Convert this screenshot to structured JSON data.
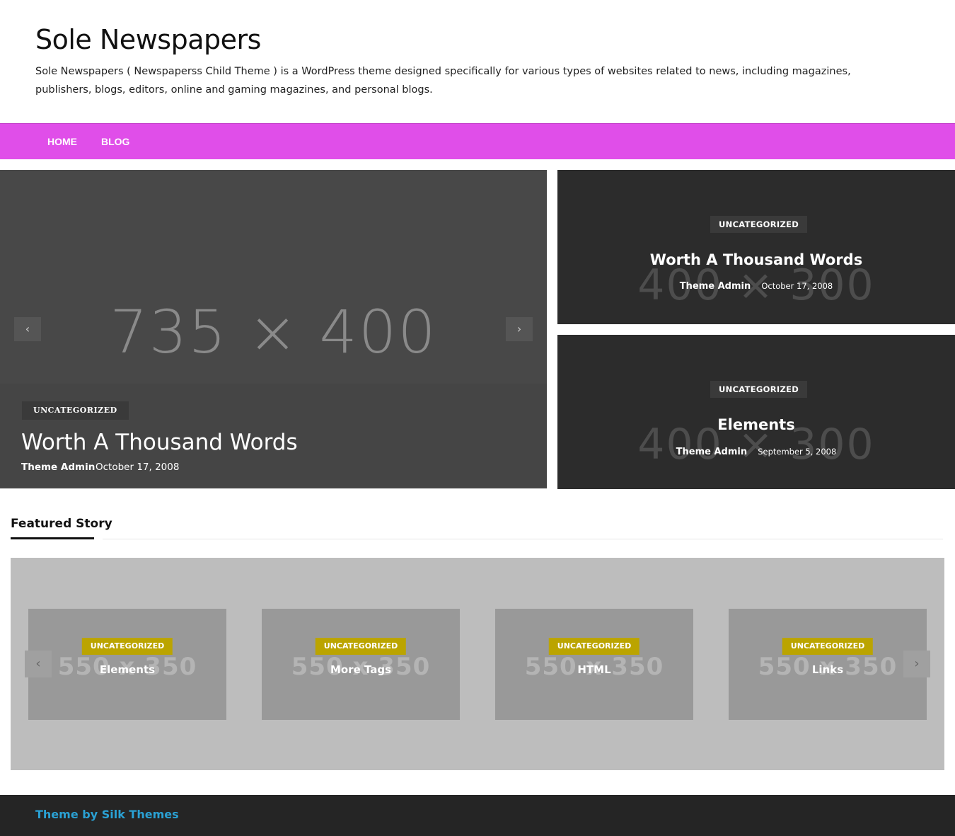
{
  "site": {
    "title": "Sole Newspapers",
    "description": "Sole Newspapers ( Newspaperss Child Theme ) is a WordPress theme designed specifically for various types of websites related to news, including magazines, publishers, blogs, editors, online and gaming magazines, and personal blogs."
  },
  "nav": {
    "items": [
      {
        "label": "HOME"
      },
      {
        "label": "BLOG"
      }
    ],
    "color": "#e04ee9"
  },
  "hero": {
    "placeholder": "735 × 400",
    "category": "UNCATEGORIZED",
    "title": "Worth A Thousand Words",
    "author": "Theme Admin",
    "date": "October 17, 2008",
    "prev_icon": "chevron-left-icon",
    "next_icon": "chevron-right-icon"
  },
  "side_posts": [
    {
      "placeholder": "400 × 300",
      "category": "UNCATEGORIZED",
      "title": "Worth A Thousand Words",
      "author": "Theme Admin",
      "date": "October 17, 2008"
    },
    {
      "placeholder": "400 × 300",
      "category": "UNCATEGORIZED",
      "title": "Elements",
      "author": "Theme Admin",
      "date": "September 5, 2008"
    }
  ],
  "featured": {
    "heading": "Featured Story",
    "cards": [
      {
        "placeholder": "550 x 350",
        "category": "UNCATEGORIZED",
        "title": "Elements"
      },
      {
        "placeholder": "550 x 350",
        "category": "UNCATEGORIZED",
        "title": "More Tags"
      },
      {
        "placeholder": "550 x 350",
        "category": "UNCATEGORIZED",
        "title": "HTML"
      },
      {
        "placeholder": "550 x 350",
        "category": "UNCATEGORIZED",
        "title": "Links"
      }
    ],
    "category_color": "#bba400"
  },
  "footer": {
    "credit": "Theme by Silk Themes",
    "credit_color": "#2aa1d4"
  }
}
